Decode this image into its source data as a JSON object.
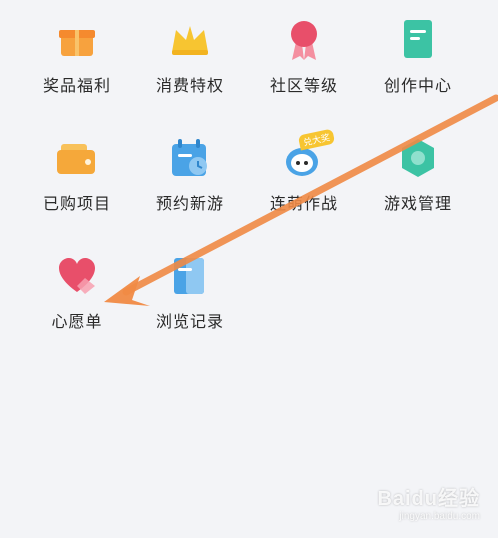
{
  "menu": {
    "items": [
      {
        "label": "奖品福利",
        "icon": "gift-icon"
      },
      {
        "label": "消费特权",
        "icon": "crown-icon"
      },
      {
        "label": "社区等级",
        "icon": "medal-icon"
      },
      {
        "label": "创作中心",
        "icon": "note-icon"
      },
      {
        "label": "已购项目",
        "icon": "wallet-icon"
      },
      {
        "label": "预约新游",
        "icon": "calendar-icon"
      },
      {
        "label": "连萌作战",
        "icon": "mascot-icon",
        "badge": "兑大奖"
      },
      {
        "label": "游戏管理",
        "icon": "hexagon-icon"
      },
      {
        "label": "心愿单",
        "icon": "heart-icon"
      },
      {
        "label": "浏览记录",
        "icon": "history-icon"
      }
    ]
  },
  "annotation": {
    "type": "arrow",
    "color": "#f08a45"
  },
  "watermark": {
    "main": "Baidu经验",
    "sub": "jingyan.baidu.com"
  },
  "colors": {
    "background": "#f3f4f7",
    "gift": "#f7a23e",
    "crown": "#f7c531",
    "medal": "#e84f6a",
    "teal": "#3cc3a4",
    "wallet": "#f5a83a",
    "blue": "#4aa3e6"
  }
}
